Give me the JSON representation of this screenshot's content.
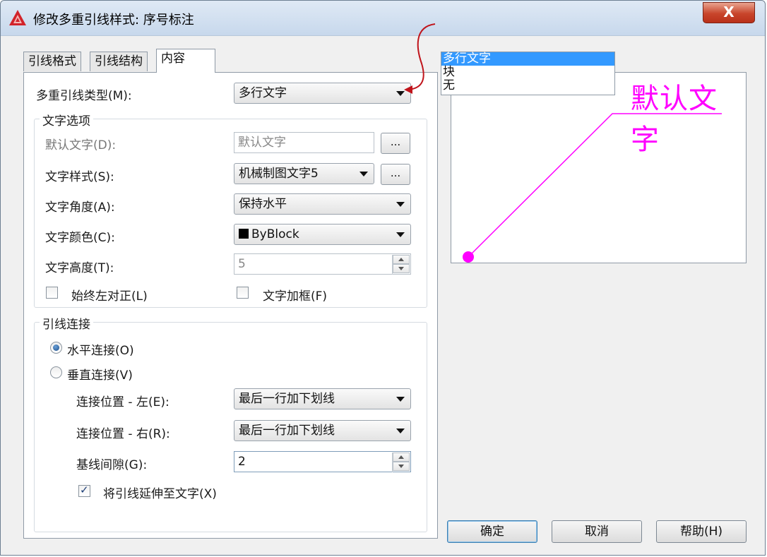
{
  "window": {
    "title": "修改多重引线样式: 序号标注",
    "close_label": "X"
  },
  "tabs": [
    {
      "label": "引线格式",
      "active": false
    },
    {
      "label": "引线结构",
      "active": false
    },
    {
      "label": "内容",
      "active": true
    }
  ],
  "content": {
    "leader_type_label": "多重引线类型(M):",
    "leader_type_value": "多行文字",
    "dropdown_options": [
      "多行文字",
      "块",
      "无"
    ],
    "dropdown_selected": "多行文字",
    "text_options": {
      "title": "文字选项",
      "default_text_label": "默认文字(D):",
      "default_text_value": "默认文字",
      "default_text_button": "...",
      "text_style_label": "文字样式(S):",
      "text_style_value": "机械制图文字5",
      "text_style_button": "...",
      "text_angle_label": "文字角度(A):",
      "text_angle_value": "保持水平",
      "text_color_label": "文字颜色(C):",
      "text_color_value": "ByBlock",
      "text_height_label": "文字高度(T):",
      "text_height_value": "5",
      "always_left_label": "始终左对正(L)",
      "always_left_checked": false,
      "text_frame_label": "文字加框(F)",
      "text_frame_checked": false
    },
    "leader_connection": {
      "title": "引线连接",
      "horizontal_label": "水平连接(O)",
      "vertical_label": "垂直连接(V)",
      "selected": "horizontal",
      "left_pos_label": "连接位置 - 左(E):",
      "left_pos_value": "最后一行加下划线",
      "right_pos_label": "连接位置 - 右(R):",
      "right_pos_value": "最后一行加下划线",
      "baseline_gap_label": "基线间隙(G):",
      "baseline_gap_value": "2",
      "extend_leader_label": "将引线延伸至文字(X)",
      "extend_leader_checked": true
    }
  },
  "preview": {
    "text": "默认文字",
    "color": "#ff00ff"
  },
  "buttons": {
    "ok": "确定",
    "cancel": "取消",
    "help": "帮助(H)"
  },
  "colors": {
    "accent": "#3399ff",
    "annotation_arrow": "#c0141b",
    "preview_magenta": "#ff00ff"
  }
}
